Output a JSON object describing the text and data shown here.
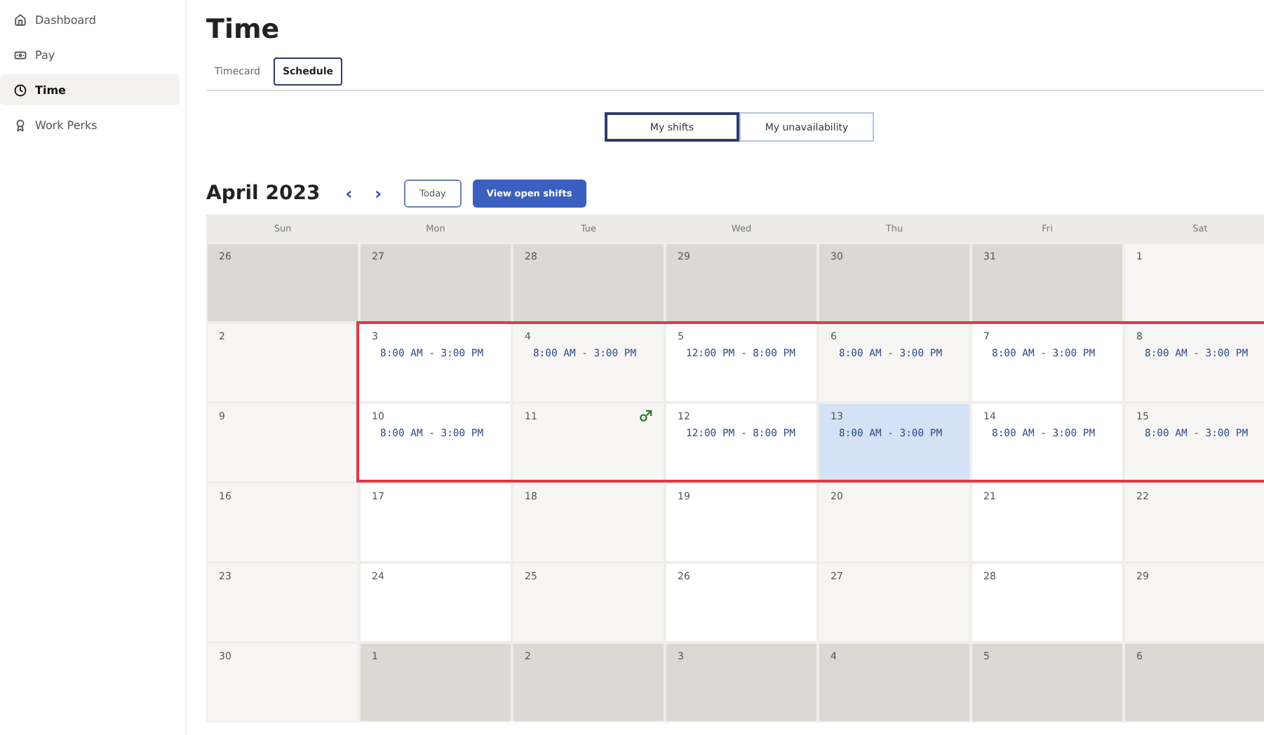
{
  "sidebar": {
    "items": [
      {
        "label": "Dashboard",
        "selected": false
      },
      {
        "label": "Pay",
        "selected": false
      },
      {
        "label": "Time",
        "selected": true
      },
      {
        "label": "Work Perks",
        "selected": false
      }
    ]
  },
  "page": {
    "title": "Time"
  },
  "tabs": [
    {
      "label": "Timecard",
      "selected": false
    },
    {
      "label": "Schedule",
      "selected": true
    }
  ],
  "view_toggle": [
    {
      "label": "My shifts",
      "selected": true
    },
    {
      "label": "My unavailability",
      "selected": false
    }
  ],
  "calendar": {
    "month": "April 2023",
    "prev": "‹",
    "next": "›",
    "today_button": "Today",
    "open_shifts_button": "View open shifts",
    "weekdays": [
      "Sun",
      "Mon",
      "Tue",
      "Wed",
      "Thu",
      "Fri",
      "Sat"
    ],
    "weeks": [
      {
        "highlighted": false,
        "days": [
          {
            "date": "26",
            "outside": true,
            "today": false
          },
          {
            "date": "27",
            "outside": true,
            "today": false
          },
          {
            "date": "28",
            "outside": true,
            "today": false
          },
          {
            "date": "29",
            "outside": true,
            "today": false
          },
          {
            "date": "30",
            "outside": true,
            "today": false
          },
          {
            "date": "31",
            "outside": true,
            "today": false
          },
          {
            "date": "1",
            "outside": false,
            "today": false
          }
        ]
      },
      {
        "highlighted": true,
        "days": [
          {
            "date": "2",
            "outside": false,
            "today": false
          },
          {
            "date": "3",
            "outside": false,
            "today": false,
            "shift": "8:00 AM - 3:00 PM"
          },
          {
            "date": "4",
            "outside": false,
            "today": false,
            "shift": "8:00 AM - 3:00 PM"
          },
          {
            "date": "5",
            "outside": false,
            "today": false,
            "shift": "12:00 PM - 8:00 PM"
          },
          {
            "date": "6",
            "outside": false,
            "today": false,
            "shift": "8:00 AM - 3:00 PM"
          },
          {
            "date": "7",
            "outside": false,
            "today": false,
            "shift": "8:00 AM - 3:00 PM"
          },
          {
            "date": "8",
            "outside": false,
            "today": false,
            "shift": "8:00 AM - 3:00 PM"
          }
        ]
      },
      {
        "highlighted": true,
        "days": [
          {
            "date": "9",
            "outside": false,
            "today": false
          },
          {
            "date": "10",
            "outside": false,
            "today": false,
            "shift": "8:00 AM - 3:00 PM"
          },
          {
            "date": "11",
            "outside": false,
            "today": false,
            "marker": true
          },
          {
            "date": "12",
            "outside": false,
            "today": false,
            "shift": "12:00 PM - 8:00 PM"
          },
          {
            "date": "13",
            "outside": false,
            "today": true,
            "shift": "8:00 AM - 3:00 PM"
          },
          {
            "date": "14",
            "outside": false,
            "today": false,
            "shift": "8:00 AM - 3:00 PM"
          },
          {
            "date": "15",
            "outside": false,
            "today": false,
            "shift": "8:00 AM - 3:00 PM"
          }
        ]
      },
      {
        "highlighted": false,
        "days": [
          {
            "date": "16",
            "outside": false,
            "today": false
          },
          {
            "date": "17",
            "outside": false,
            "today": false
          },
          {
            "date": "18",
            "outside": false,
            "today": false
          },
          {
            "date": "19",
            "outside": false,
            "today": false
          },
          {
            "date": "20",
            "outside": false,
            "today": false
          },
          {
            "date": "21",
            "outside": false,
            "today": false
          },
          {
            "date": "22",
            "outside": false,
            "today": false
          }
        ]
      },
      {
        "highlighted": false,
        "days": [
          {
            "date": "23",
            "outside": false,
            "today": false
          },
          {
            "date": "24",
            "outside": false,
            "today": false
          },
          {
            "date": "25",
            "outside": false,
            "today": false
          },
          {
            "date": "26",
            "outside": false,
            "today": false
          },
          {
            "date": "27",
            "outside": false,
            "today": false
          },
          {
            "date": "28",
            "outside": false,
            "today": false
          },
          {
            "date": "29",
            "outside": false,
            "today": false
          }
        ]
      },
      {
        "highlighted": false,
        "days": [
          {
            "date": "30",
            "outside": false,
            "today": false
          },
          {
            "date": "1",
            "outside": true,
            "today": false
          },
          {
            "date": "2",
            "outside": true,
            "today": false
          },
          {
            "date": "3",
            "outside": true,
            "today": false
          },
          {
            "date": "4",
            "outside": true,
            "today": false
          },
          {
            "date": "5",
            "outside": true,
            "today": false
          },
          {
            "date": "6",
            "outside": true,
            "today": false
          }
        ]
      }
    ]
  }
}
